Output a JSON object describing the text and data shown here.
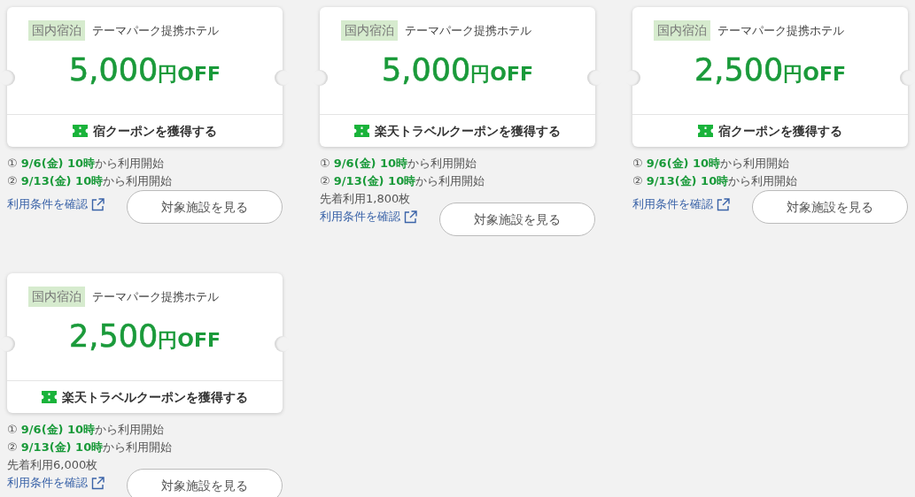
{
  "coupons": [
    {
      "category": "国内宿泊",
      "title": "テーマパーク提携ホテル",
      "amount": "5,000",
      "unit": "円OFF",
      "action": "宿クーポンを獲得する",
      "schedule": [
        "① **9/6(金) 10時**から利用開始",
        "② **9/13(金) 10時**から利用開始"
      ],
      "link": "利用条件を確認",
      "button": "対象施設を見る"
    },
    {
      "category": "国内宿泊",
      "title": "テーマパーク提携ホテル",
      "amount": "5,000",
      "unit": "円OFF",
      "action": "楽天トラベルクーポンを獲得する",
      "schedule": [
        "① **9/6(金) 10時**から利用開始",
        "② **9/13(金) 10時**から利用開始"
      ],
      "limit": "先着利用1,800枚",
      "link": "利用条件を確認",
      "button": "対象施設を見る"
    },
    {
      "category": "国内宿泊",
      "title": "テーマパーク提携ホテル",
      "amount": "2,500",
      "unit": "円OFF",
      "action": "宿クーポンを獲得する",
      "schedule": [
        "① **9/6(金) 10時**から利用開始",
        "② **9/13(金) 10時**から利用開始"
      ],
      "link": "利用条件を確認",
      "button": "対象施設を見る"
    },
    {
      "category": "国内宿泊",
      "title": "テーマパーク提携ホテル",
      "amount": "2,500",
      "unit": "円OFF",
      "action": "楽天トラベルクーポンを獲得する",
      "schedule": [
        "① **9/6(金) 10時**から利用開始",
        "② **9/13(金) 10時**から利用開始"
      ],
      "limit": "先着利用6,000枚",
      "link": "利用条件を確認",
      "button": "対象施設を見る"
    }
  ]
}
